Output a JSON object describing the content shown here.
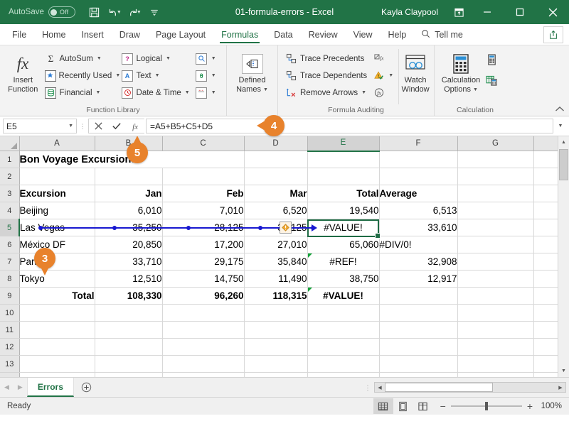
{
  "titlebar": {
    "autosave_label": "AutoSave",
    "autosave_state": "Off",
    "document_title": "01-formula-errors  -  Excel",
    "user_name": "Kayla Claypool",
    "save_icon": "save-icon",
    "undo_icon": "undo-icon",
    "redo_icon": "redo-icon",
    "qat_more_icon": "qat-customize-icon",
    "ribbon_display_icon": "ribbon-display-options-icon",
    "minimize_icon": "minimize-icon",
    "restore_icon": "restore-icon",
    "close_icon": "close-icon"
  },
  "tabs": {
    "items": [
      {
        "label": "File",
        "active": false
      },
      {
        "label": "Home",
        "active": false
      },
      {
        "label": "Insert",
        "active": false
      },
      {
        "label": "Draw",
        "active": false
      },
      {
        "label": "Page Layout",
        "active": false
      },
      {
        "label": "Formulas",
        "active": true
      },
      {
        "label": "Data",
        "active": false
      },
      {
        "label": "Review",
        "active": false
      },
      {
        "label": "View",
        "active": false
      },
      {
        "label": "Help",
        "active": false
      }
    ],
    "tell_me": "Tell me",
    "share_icon": "share-icon"
  },
  "ribbon": {
    "function_library": {
      "group_label": "Function Library",
      "insert_function": {
        "line1": "Insert",
        "line2": "Function",
        "icon": "fx-icon"
      },
      "buttons": [
        {
          "label": "AutoSum",
          "icon": "autosum-sigma-icon"
        },
        {
          "label": "Recently Used",
          "icon": "recently-used-icon"
        },
        {
          "label": "Financial",
          "icon": "financial-icon"
        },
        {
          "label": "Logical",
          "icon": "logical-icon"
        },
        {
          "label": "Text",
          "icon": "text-icon"
        },
        {
          "label": "Date & Time",
          "icon": "date-time-icon"
        }
      ],
      "extra_icons": [
        {
          "icon": "lookup-reference-icon"
        },
        {
          "icon": "math-trig-icon"
        },
        {
          "icon": "more-functions-icon"
        }
      ]
    },
    "defined_names": {
      "group_label": "",
      "line1": "Defined",
      "line2": "Names",
      "icon": "defined-names-icon"
    },
    "formula_auditing": {
      "group_label": "Formula Auditing",
      "buttons": [
        {
          "label": "Trace Precedents",
          "icon": "trace-precedents-icon"
        },
        {
          "label": "Trace Dependents",
          "icon": "trace-dependents-icon"
        },
        {
          "label": "Remove Arrows",
          "icon": "remove-arrows-icon"
        }
      ],
      "side_icons": [
        {
          "icon": "show-formulas-icon"
        },
        {
          "icon": "error-checking-icon"
        },
        {
          "icon": "evaluate-formula-icon"
        }
      ],
      "watch_window": {
        "line1": "Watch",
        "line2": "Window",
        "icon": "watch-window-icon"
      }
    },
    "calculation": {
      "group_label": "Calculation",
      "options": {
        "line1": "Calculation",
        "line2": "Options",
        "icon": "calculation-options-icon"
      },
      "calc_now_icon": "calculate-now-icon",
      "calc_sheet_icon": "calculate-sheet-icon"
    },
    "collapse_icon": "collapse-ribbon-icon"
  },
  "formula_bar": {
    "name_box_value": "E5",
    "name_box_caret": "chevron-down-icon",
    "cancel_icon": "cancel-icon",
    "enter_icon": "enter-icon",
    "insert_function_icon": "insert-function-fx-icon",
    "formula_value": "=A5+B5+C5+D5",
    "expand_caret": "chevron-down-icon"
  },
  "grid": {
    "columns": [
      "A",
      "B",
      "C",
      "D",
      "E",
      "F",
      "G"
    ],
    "selected_column": "E",
    "selected_row": 5,
    "selected_cell": "E5",
    "rows": [
      {
        "num": 1,
        "cells": [
          {
            "v": "Bon Voyage Excursions",
            "cls": "title",
            "span": 3
          },
          {
            "v": ""
          },
          {
            "v": ""
          },
          {
            "v": ""
          },
          {
            "v": ""
          }
        ]
      },
      {
        "num": 2,
        "cells": [
          {
            "v": ""
          },
          {
            "v": ""
          },
          {
            "v": ""
          },
          {
            "v": ""
          },
          {
            "v": ""
          },
          {
            "v": ""
          },
          {
            "v": ""
          }
        ]
      },
      {
        "num": 3,
        "cells": [
          {
            "v": "Excursion",
            "cls": "b"
          },
          {
            "v": "Jan",
            "cls": "r b"
          },
          {
            "v": "Feb",
            "cls": "r b"
          },
          {
            "v": "Mar",
            "cls": "r b"
          },
          {
            "v": "Total",
            "cls": "r b"
          },
          {
            "v": "Average",
            "cls": "b"
          },
          {
            "v": ""
          }
        ]
      },
      {
        "num": 4,
        "cells": [
          {
            "v": "Beijing"
          },
          {
            "v": "6,010",
            "cls": "r"
          },
          {
            "v": "7,010",
            "cls": "r"
          },
          {
            "v": "6,520",
            "cls": "r"
          },
          {
            "v": "19,540",
            "cls": "r"
          },
          {
            "v": "6,513",
            "cls": "r"
          },
          {
            "v": ""
          }
        ]
      },
      {
        "num": 5,
        "cells": [
          {
            "v": "Las Vegas"
          },
          {
            "v": "35,250",
            "cls": "r"
          },
          {
            "v": "28,125",
            "cls": "r"
          },
          {
            "v": "37,125",
            "cls": "r"
          },
          {
            "v": "#VALUE!",
            "cls": "c"
          },
          {
            "v": "33,610",
            "cls": "r"
          },
          {
            "v": ""
          }
        ]
      },
      {
        "num": 6,
        "cells": [
          {
            "v": "México DF"
          },
          {
            "v": "20,850",
            "cls": "r"
          },
          {
            "v": "17,200",
            "cls": "r"
          },
          {
            "v": "27,010",
            "cls": "r"
          },
          {
            "v": "65,060",
            "cls": "r"
          },
          {
            "v": "#DIV/0!"
          },
          {
            "v": ""
          }
        ]
      },
      {
        "num": 7,
        "cells": [
          {
            "v": "Paris"
          },
          {
            "v": "33,710",
            "cls": "r"
          },
          {
            "v": "29,175",
            "cls": "r"
          },
          {
            "v": "35,840",
            "cls": "r"
          },
          {
            "v": "#REF!",
            "cls": "c",
            "err": true
          },
          {
            "v": "32,908",
            "cls": "r"
          },
          {
            "v": ""
          }
        ]
      },
      {
        "num": 8,
        "cells": [
          {
            "v": "Tokyo"
          },
          {
            "v": "12,510",
            "cls": "r"
          },
          {
            "v": "14,750",
            "cls": "r"
          },
          {
            "v": "11,490",
            "cls": "r"
          },
          {
            "v": "38,750",
            "cls": "r"
          },
          {
            "v": "12,917",
            "cls": "r"
          },
          {
            "v": ""
          }
        ]
      },
      {
        "num": 9,
        "cells": [
          {
            "v": "Total",
            "cls": "r b"
          },
          {
            "v": "108,330",
            "cls": "r b"
          },
          {
            "v": "96,260",
            "cls": "r b"
          },
          {
            "v": "118,315",
            "cls": "r b"
          },
          {
            "v": "#VALUE!",
            "cls": "c b",
            "err": true
          },
          {
            "v": "",
            "cls": "r b"
          },
          {
            "v": ""
          }
        ]
      },
      {
        "num": 10,
        "cells": [
          {
            "v": ""
          },
          {
            "v": ""
          },
          {
            "v": ""
          },
          {
            "v": ""
          },
          {
            "v": ""
          },
          {
            "v": ""
          },
          {
            "v": ""
          }
        ]
      },
      {
        "num": 11,
        "cells": [
          {
            "v": ""
          },
          {
            "v": ""
          },
          {
            "v": ""
          },
          {
            "v": ""
          },
          {
            "v": ""
          },
          {
            "v": ""
          },
          {
            "v": ""
          }
        ]
      },
      {
        "num": 12,
        "cells": [
          {
            "v": ""
          },
          {
            "v": ""
          },
          {
            "v": ""
          },
          {
            "v": ""
          },
          {
            "v": ""
          },
          {
            "v": ""
          },
          {
            "v": ""
          }
        ]
      },
      {
        "num": 13,
        "cells": [
          {
            "v": ""
          },
          {
            "v": ""
          },
          {
            "v": ""
          },
          {
            "v": ""
          },
          {
            "v": ""
          },
          {
            "v": ""
          },
          {
            "v": ""
          }
        ]
      }
    ],
    "trace_arrow": {
      "from": "A5",
      "to": "E5",
      "color": "#1818d0"
    },
    "warning_icon": {
      "cell": "D5",
      "icon": "error-warning-icon"
    }
  },
  "sheet_tabs": {
    "prev_icon": "prev-sheet-icon",
    "next_icon": "next-sheet-icon",
    "tabs": [
      {
        "label": "Errors",
        "active": true
      }
    ],
    "add_sheet_icon": "add-sheet-icon"
  },
  "statusbar": {
    "status_text": "Ready",
    "views": [
      {
        "icon": "normal-view-icon",
        "active": true
      },
      {
        "icon": "page-layout-view-icon",
        "active": false
      },
      {
        "icon": "page-break-preview-icon",
        "active": false
      }
    ],
    "zoom_out_icon": "zoom-out-icon",
    "zoom_in_icon": "zoom-in-icon",
    "zoom_level": "100%"
  },
  "callouts": [
    {
      "number": "3",
      "target": "row-7-excursion"
    },
    {
      "number": "4",
      "target": "formula-bar"
    },
    {
      "number": "5",
      "target": "column-b-header"
    }
  ],
  "colors": {
    "brand_green": "#217346",
    "callout_orange": "#e8822c",
    "trace_blue": "#1818d0",
    "error_triangle_green": "#12a237"
  }
}
